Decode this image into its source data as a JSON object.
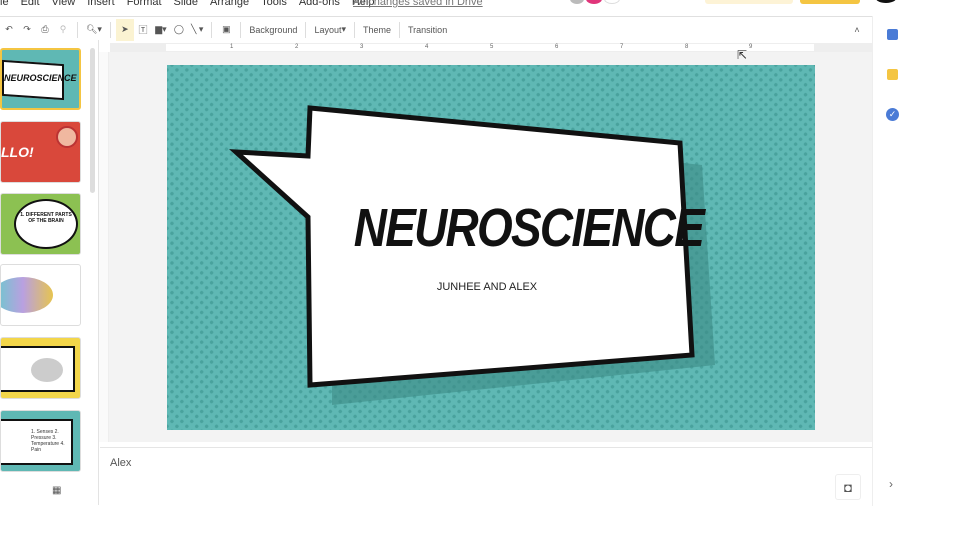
{
  "menu": {
    "items": [
      "le",
      "Edit",
      "View",
      "Insert",
      "Format",
      "Slide",
      "Arrange",
      "Tools",
      "Add-ons",
      "Help"
    ],
    "status": "All changes saved in Drive"
  },
  "toolbar": {
    "background": "Background",
    "layout": "Layout",
    "theme": "Theme",
    "transition": "Transition"
  },
  "ruler": {
    "marks": [
      "1",
      "2",
      "3",
      "4",
      "5",
      "6",
      "7",
      "8",
      "9"
    ]
  },
  "filmstrip": {
    "slides": [
      {
        "text": "NEUROSCIENCE",
        "color": "#5fb8b4"
      },
      {
        "text": "LLO!",
        "color": "#d9483b"
      },
      {
        "text": "1. DIFFERENT PARTS OF THE BRAIN",
        "color": "#8cc152"
      },
      {
        "text": "",
        "color": "#ffffff"
      },
      {
        "text": "",
        "color": "#f3d64a"
      },
      {
        "text": "1. Senses 2. Pressure 3. Temperature 4. Pain",
        "color": "#5fb8b4"
      }
    ]
  },
  "slide": {
    "title": "NEUROSCIENCE",
    "subtitle": "JUNHEE AND ALEX",
    "bg": "#5fb8b4"
  },
  "notes": {
    "text": "Alex"
  },
  "colors": {
    "accent_yellow": "#f4c542",
    "teal": "#5fb8b4"
  }
}
